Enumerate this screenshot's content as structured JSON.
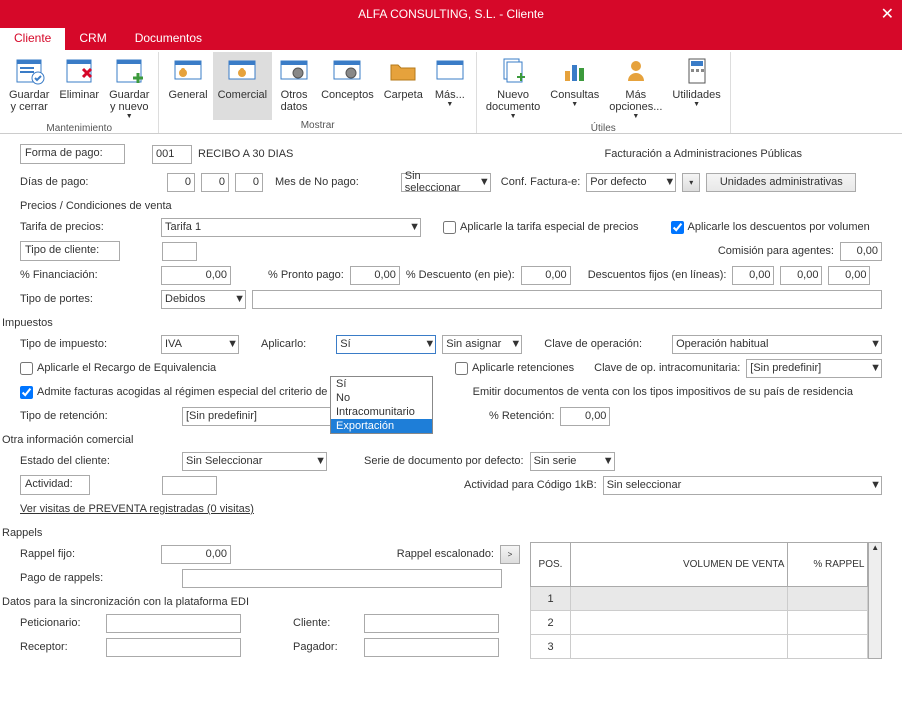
{
  "title": "ALFA CONSULTING, S.L. - Cliente",
  "tabs": {
    "cliente": "Cliente",
    "crm": "CRM",
    "documentos": "Documentos"
  },
  "ribbon": {
    "grp1": {
      "name": "Mantenimiento",
      "b1": "Guardar\ny cerrar",
      "b2": "Eliminar",
      "b3": "Guardar\ny nuevo"
    },
    "grp2": {
      "name": "Mostrar",
      "b1": "General",
      "b2": "Comercial",
      "b3": "Otros\ndatos",
      "b4": "Conceptos",
      "b5": "Carpeta",
      "b6": "Más..."
    },
    "grp3": {
      "name": "Útiles",
      "b1": "Nuevo\ndocumento",
      "b2": "Consultas",
      "b3": "Más\nopciones...",
      "b4": "Utilidades"
    }
  },
  "f": {
    "forma_pago_l": "Forma de pago:",
    "forma_pago_code": "001",
    "forma_pago_desc": "RECIBO A 30 DIAS",
    "fact_admin": "Facturación a Administraciones Públicas",
    "dias_pago_l": "Días de pago:",
    "d1": "0",
    "d2": "0",
    "d3": "0",
    "mes_no_l": "Mes de No pago:",
    "mes_no_v": "Sin seleccionar",
    "conf_e_l": "Conf. Factura-e:",
    "conf_e_v": "Por defecto",
    "unidades": "Unidades administrativas",
    "sec_precios": "Precios / Condiciones de venta",
    "tarifa_l": "Tarifa de precios:",
    "tarifa_v": "Tarifa 1",
    "tarifa_esp": "Aplicarle la tarifa especial de precios",
    "desc_vol": "Aplicarle los descuentos por volumen",
    "tipo_cli_l": "Tipo de cliente:",
    "comis_l": "Comisión para agentes:",
    "comis_v": "0,00",
    "fin_l": "% Financiación:",
    "fin_v": "0,00",
    "pronto_l": "% Pronto pago:",
    "pronto_v": "0,00",
    "descpie_l": "% Descuento (en pie):",
    "descpie_v": "0,00",
    "descfijo_l": "Descuentos fijos (en líneas):",
    "df1": "0,00",
    "df2": "0,00",
    "df3": "0,00",
    "portes_l": "Tipo de portes:",
    "portes_v": "Debidos",
    "sec_imp": "Impuestos",
    "tipo_imp_l": "Tipo de impuesto:",
    "tipo_imp_v": "IVA",
    "aplicar_l": "Aplicarlo:",
    "aplicar_v": "Sí",
    "aplicar_dest": "Sin asignar",
    "clave_op_l": "Clave de operación:",
    "clave_op_v": "Operación habitual",
    "recargo": "Aplicarle el Recargo de Equivalencia",
    "ret_chk": "Aplicarle retenciones",
    "clave_intra_l": "Clave de op. intracomunitaria:",
    "clave_intra_v": "[Sin predefinir]",
    "regimen": "Admite facturas acogidas al régimen especial del criterio de caja",
    "regimen2": "Emitir documentos de venta con los tipos impositivos de su país de residencia",
    "tipo_ret_l": "Tipo de retención:",
    "tipo_ret_v": "[Sin predefinir]",
    "pct_ret_l": "% Retención:",
    "pct_ret_v": "0,00",
    "dd_opts": [
      "Sí",
      "No",
      "Intracomunitario",
      "Exportación"
    ],
    "sec_otra": "Otra información comercial",
    "estado_l": "Estado del cliente:",
    "estado_v": "Sin Seleccionar",
    "serie_l": "Serie de documento por defecto:",
    "serie_v": "Sin serie",
    "actividad_l": "Actividad:",
    "act1kb_l": "Actividad para Código 1kB:",
    "act1kb_v": "Sin seleccionar",
    "visitas": "Ver visitas de PREVENTA registradas (0 visitas)",
    "sec_rap": "Rappels",
    "rapf_l": "Rappel fijo:",
    "rapf_v": "0,00",
    "rape_l": "Rappel escalonado:",
    "pago_rap_l": "Pago de rappels:",
    "th_pos": "POS.",
    "th_vol": "VOLUMEN DE VENTA",
    "th_pct": "% RAPPEL",
    "r1": "1",
    "r2": "2",
    "r3": "3",
    "sec_edi": "Datos para la sincronización con la plataforma EDI",
    "pet_l": "Peticionario:",
    "cli_l": "Cliente:",
    "rec_l": "Receptor:",
    "pag_l": "Pagador:"
  }
}
